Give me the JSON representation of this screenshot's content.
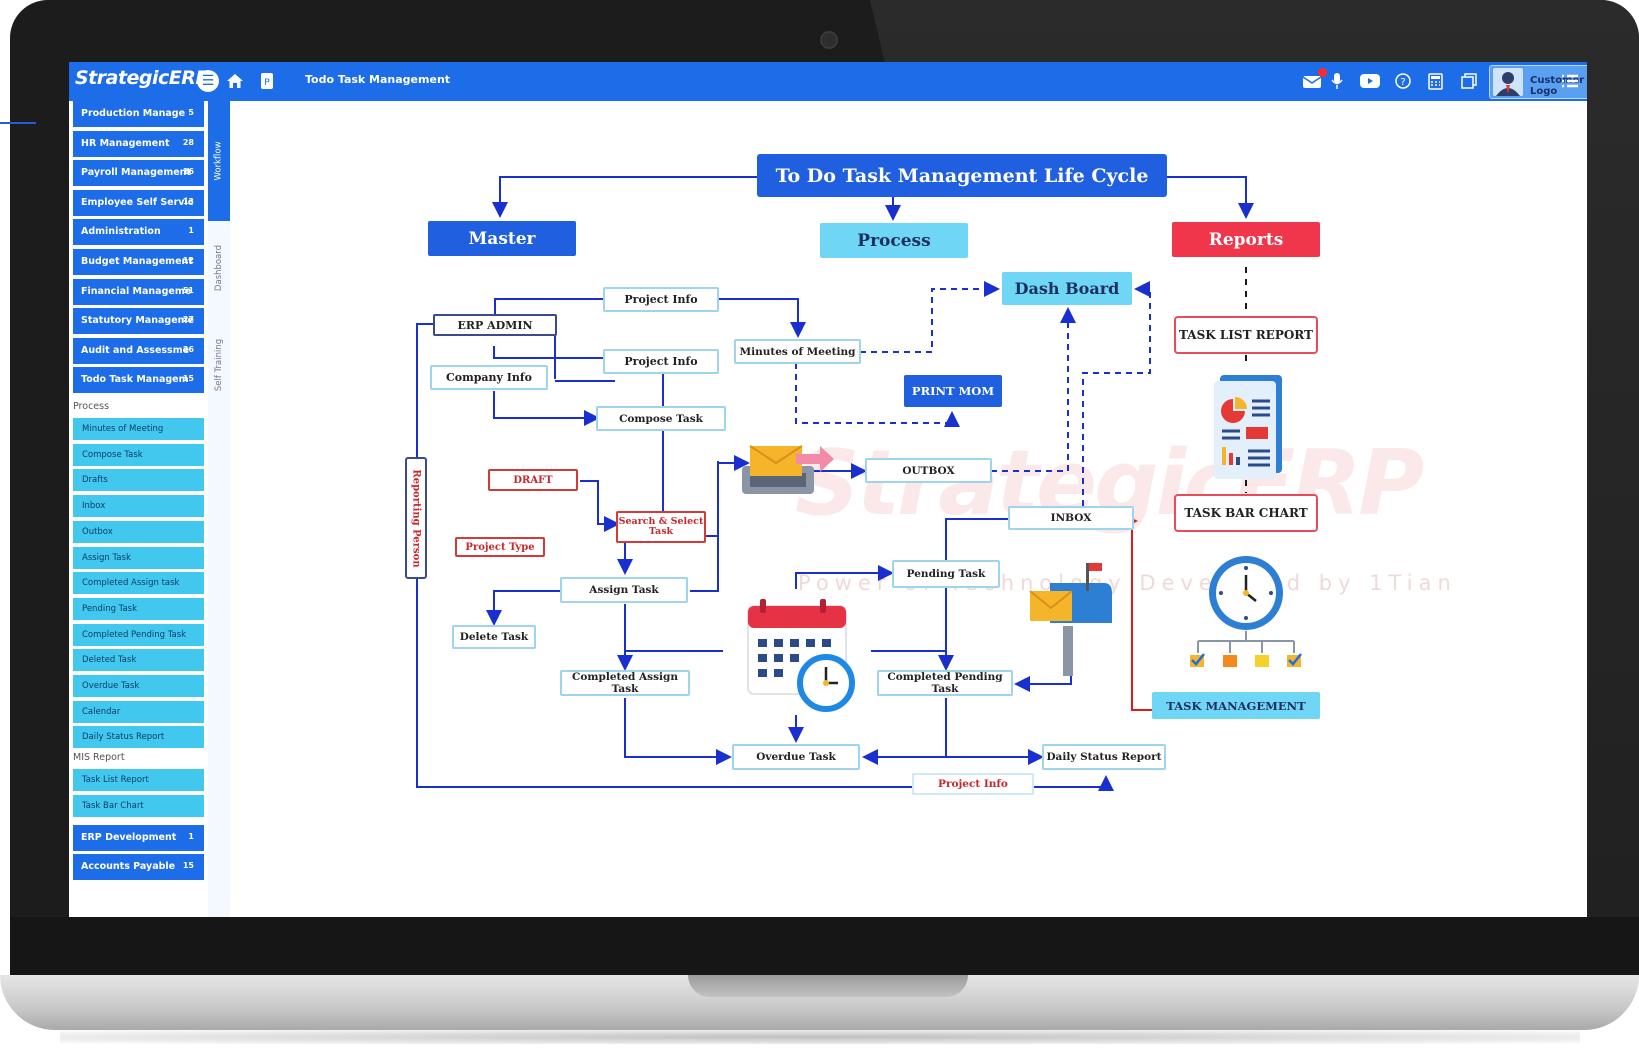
{
  "app": {
    "brand": "StrategicERP",
    "page_title": "Todo Task Management",
    "customer_logo": "Customer Logo",
    "topbar_icons": [
      "menu-circle-icon",
      "home-icon",
      "pin-icon",
      "mail-icon",
      "mic-icon",
      "youtube-icon",
      "help-icon",
      "calculator-icon",
      "copy-icon",
      "list-menu-icon"
    ]
  },
  "sidebar": {
    "modules_top": [
      {
        "label": "Production Manage",
        "count": "5"
      },
      {
        "label": "HR Management",
        "count": "28"
      },
      {
        "label": "Payroll Management",
        "count": "16"
      },
      {
        "label": "Employee Self Servic",
        "count": "13"
      },
      {
        "label": "Administration",
        "count": "1"
      },
      {
        "label": "Budget Management",
        "count": "12"
      },
      {
        "label": "Financial Manageme",
        "count": "51"
      },
      {
        "label": "Statutory Manageme",
        "count": "27"
      },
      {
        "label": "Audit and Assessme",
        "count": "26"
      },
      {
        "label": "Todo Task Managem",
        "count": "15"
      }
    ],
    "process_label": "Process",
    "process_items": [
      "Minutes of Meeting",
      "Compose Task",
      "Drafts",
      "Inbox",
      "Outbox",
      "Assign Task",
      "Completed Assign task",
      "Pending Task",
      "Completed Pending Task",
      "Deleted Task",
      "Overdue Task",
      "Calendar",
      "Daily Status Report"
    ],
    "mis_label": "MIS Report",
    "mis_items": [
      "Task List Report",
      "Task Bar Chart"
    ],
    "modules_bottom": [
      {
        "label": "ERP Development",
        "count": "1"
      },
      {
        "label": "Accounts Payable",
        "count": "15"
      }
    ],
    "vertical_tabs": [
      "Workflow",
      "Dashboard",
      "Self Training"
    ]
  },
  "diagram": {
    "title": "To Do Task Management Life Cycle",
    "master": "Master",
    "process": "Process",
    "reports": "Reports",
    "dash_board": "Dash Board",
    "erp_admin": "ERP ADMIN",
    "project_info_1": "Project  Info",
    "project_info_2": "Project  Info",
    "company_info": "Company  Info",
    "minutes_of_meeting": "Minutes of  Meeting",
    "print_mom": "PRINT MOM",
    "compose_task": "Compose Task",
    "draft": "DRAFT",
    "outbox": "OUTBOX",
    "search_select": "Search & Select Task",
    "project_type": "Project Type",
    "inbox": "INBOX",
    "reporting_person": "Reporting Person",
    "assign_task": "Assign Task",
    "pending_task": "Pending Task",
    "delete_task": "Delete Task",
    "completed_assign_task": "Completed Assign Task",
    "completed_pending_task": "Completed Pending Task",
    "overdue_task": "Overdue  Task",
    "daily_status_report": "Daily Status Report",
    "project_info_bottom": "Project Info",
    "task_list_report": "TASK LIST REPORT",
    "task_bar_chart": "TASK BAR CHART",
    "task_management": "TASK MANAGEMENT",
    "watermark": "StrategicERP",
    "watermark_tagline": "Power of Technology Developed by 1Tian"
  },
  "colors": {
    "topbar": "#1e6de8",
    "module": "#1e6de8",
    "submenu": "#42c8ee",
    "header_dark": "#1f5fe0",
    "header_light": "#6fd6f5",
    "header_red": "#f0364a",
    "arrow_blue": "#1a2fd0",
    "arrow_red": "#e01b1b"
  }
}
